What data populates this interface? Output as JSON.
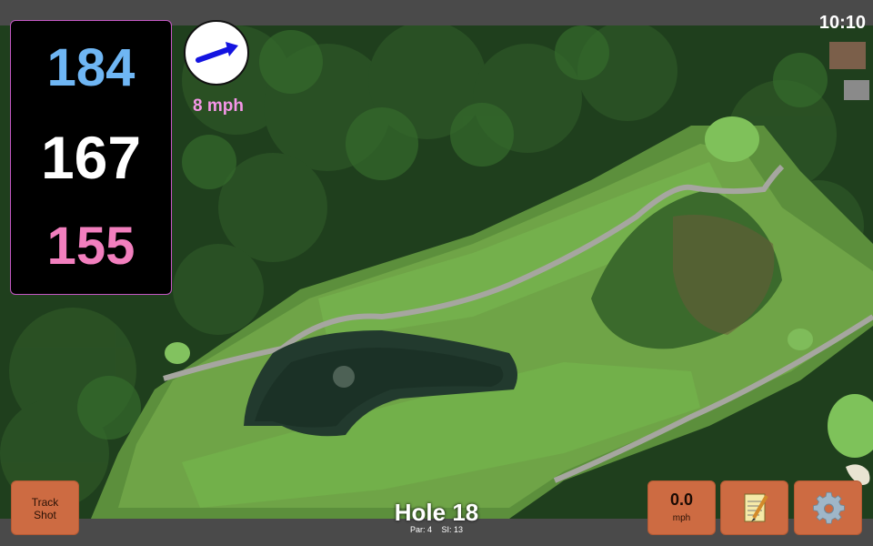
{
  "status": {
    "time": "10:10"
  },
  "distances": {
    "back": "184",
    "middle": "167",
    "front": "155"
  },
  "wind": {
    "speed_label": "8 mph",
    "direction_icon": "arrow-icon"
  },
  "hole": {
    "title": "Hole 18",
    "par": "Par: 4",
    "stroke_index": "SI: 13"
  },
  "buttons": {
    "track_shot": "Track Shot",
    "wind_value": "0.0",
    "wind_unit": "mph",
    "notes_icon": "notepad-icon",
    "settings_icon": "gear-icon"
  },
  "colors": {
    "back_distance": "#6fb6f4",
    "middle_distance": "#ffffff",
    "front_distance": "#f27fbe",
    "wind_label": "#f596e8",
    "button_bg": "#cd6b42",
    "bar_bg": "#4a4a4a"
  }
}
